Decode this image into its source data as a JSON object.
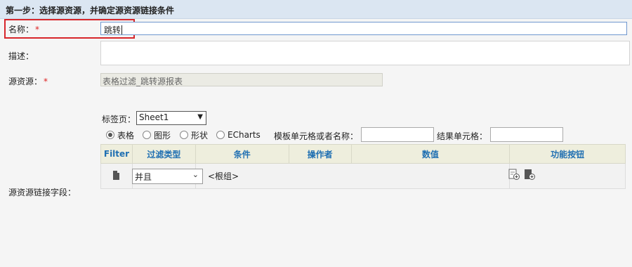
{
  "header": {
    "title": "第一步：选择源资源，并确定源资源链接条件"
  },
  "form": {
    "name_label": "名称：",
    "name_required": "*",
    "name_value": "跳转",
    "desc_label": "描述：",
    "source_label": "源资源：",
    "source_required": "*",
    "source_value": "表格过滤_跳转源报表",
    "link_field_label": "源资源链接字段："
  },
  "sheet": {
    "tab_label": "标签页：",
    "selected": "Sheet1",
    "arrow": "▼"
  },
  "radios": [
    {
      "label": "表格",
      "checked": true
    },
    {
      "label": "图形",
      "checked": false
    },
    {
      "label": "形状",
      "checked": false
    },
    {
      "label": "ECharts",
      "checked": false
    }
  ],
  "template_cell_label": "模板单元格或者名称：",
  "result_cell_label": "结果单元格：",
  "table": {
    "headers": [
      "Filter",
      "过滤类型",
      "条件",
      "操作者",
      "数值",
      "功能按钮"
    ],
    "row": {
      "filter_type": "并且",
      "condition": "<根组>"
    }
  },
  "icons": {
    "filter_row": "document-icon",
    "add_condition": "add-condition-icon",
    "add_group": "add-group-icon"
  }
}
